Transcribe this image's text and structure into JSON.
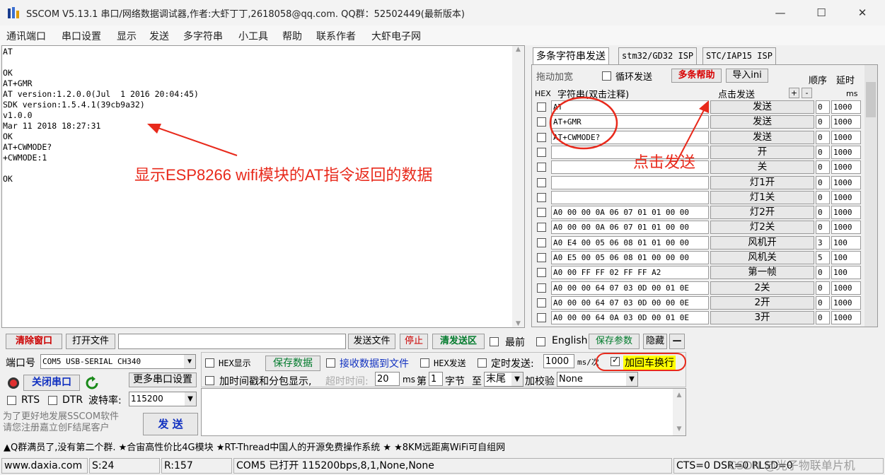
{
  "window": {
    "title": "SSCOM V5.13.1 串口/网络数据调试器,作者:大虾丁丁,2618058@qq.com. QQ群：52502449(最新版本)",
    "min": "—",
    "max": "☐",
    "close": "✕"
  },
  "menu": [
    "通讯端口",
    "串口设置",
    "显示",
    "发送",
    "多字符串",
    "小工具",
    "帮助",
    "联系作者",
    "大虾电子网"
  ],
  "receive": {
    "lines": "AT\n\nOK\nAT+GMR\nAT version:1.2.0.0(Jul  1 2016 20:04:45)\nSDK version:1.5.4.1(39cb9a32)\nv1.0.0\nMar 11 2018 18:27:31\nOK\nAT+CWMODE?\n+CWMODE:1\n\nOK",
    "annotation": "显示ESP8266 wifi模块的AT指令返回的数据"
  },
  "tabs": [
    "多条字符串发送",
    "stm32/GD32 ISP",
    "STC/IAP15 ISP"
  ],
  "multi": {
    "drag_label": "拖动加宽",
    "loop_label": "循环发送",
    "help_btn": "多条帮助",
    "import_btn": "导入ini",
    "order_label": "顺序",
    "delay_label": "延时",
    "hex_header": "HEX",
    "str_header": "字符串(双击注释)",
    "click_send_header": "点击发送",
    "plus": "+",
    "minus": "-",
    "ms": "ms",
    "annotation": "点击发送",
    "rows": [
      {
        "text": "AT",
        "btn": "发送",
        "order": "0",
        "delay": "1000"
      },
      {
        "text": "AT+GMR",
        "btn": "发送",
        "order": "0",
        "delay": "1000"
      },
      {
        "text": "AT+CWMODE?",
        "btn": "发送",
        "order": "0",
        "delay": "1000"
      },
      {
        "text": "",
        "btn": "开",
        "order": "0",
        "delay": "1000"
      },
      {
        "text": "",
        "btn": "关",
        "order": "0",
        "delay": "1000"
      },
      {
        "text": "",
        "btn": "灯1开",
        "order": "0",
        "delay": "1000"
      },
      {
        "text": "",
        "btn": "灯1关",
        "order": "0",
        "delay": "1000"
      },
      {
        "text": "A0 00 00 0A 06 07 01 01 00 00",
        "btn": "灯2开",
        "order": "0",
        "delay": "1000"
      },
      {
        "text": "A0 00 00 0A 06 07 01 01 00 00",
        "btn": "灯2关",
        "order": "0",
        "delay": "1000"
      },
      {
        "text": "A0 E4 00 05 06 08 01 01 00 00",
        "btn": "风机开",
        "order": "3",
        "delay": "100"
      },
      {
        "text": "A0 E5 00 05 06 08 01 00 00 00",
        "btn": "风机关",
        "order": "5",
        "delay": "100"
      },
      {
        "text": "A0 00 FF FF 02 FF FF A2",
        "btn": "第一帧",
        "order": "0",
        "delay": "100"
      },
      {
        "text": "A0 00 00 64 07 03 0D 00 01 0E",
        "btn": "2关",
        "order": "0",
        "delay": "1000"
      },
      {
        "text": "A0 00 00 64 07 03 0D 00 00 0E",
        "btn": "2开",
        "order": "0",
        "delay": "1000"
      },
      {
        "text": "A0 00 00 64 0A 03 0D 00 01 0E",
        "btn": "3开",
        "order": "0",
        "delay": "1000"
      }
    ]
  },
  "toolbar": {
    "clear_btn": "清除窗口",
    "open_file_btn": "打开文件",
    "send_file_btn": "发送文件",
    "stop_btn": "停止",
    "clear_send_btn": "清发送区",
    "front_label": "最前",
    "english_label": "English",
    "save_params_btn": "保存参数",
    "hide_btn": "隐藏",
    "dash_btn": "—"
  },
  "port": {
    "port_label": "端口号",
    "port_value": "COM5 USB-SERIAL CH340",
    "more_settings_btn": "更多串口设置",
    "close_port_btn": "关闭串口",
    "rts_label": "RTS",
    "dtr_label": "DTR",
    "baud_label": "波特率:",
    "baud_value": "115200",
    "promo": "为了更好地发展SSCOM软件\n请您注册嘉立创F结尾客户",
    "send_btn": "发 送"
  },
  "options": {
    "hex_display": "HEX显示",
    "save_data_btn": "保存数据",
    "recv_to_file": "接收数据到文件",
    "hex_send": "HEX发送",
    "timed_send": "定时发送:",
    "timed_value": "1000",
    "timed_unit": "ms/次",
    "add_crlf": "加回车换行",
    "timestamp_label": "加时间戳和分包显示,",
    "timeout_label": "超时时间:",
    "timeout_value": "20",
    "ms": "ms",
    "nth_label": "第",
    "nth_value": "1",
    "byte_label": "字节",
    "to_label": "至",
    "to_value": "末尾",
    "checksum_label": "加校验",
    "checksum_value": "None"
  },
  "ticker": "▲Q群满员了,没有第二个群. ★合宙高性价比4G模块 ★RT-Thread中国人的开源免费操作系统 ★ ★8KM远距离WiFi可自组网",
  "status": {
    "site": "www.daxia.com",
    "sent": "S:24",
    "recv": "R:157",
    "port_status": "COM5 已打开  115200bps,8,1,None,None",
    "lines": "CTS=0 DSR=0 RLSD=0",
    "watermark": "CSDN @光子物联单片机"
  },
  "colors": {
    "annotation_red": "#e8291b",
    "highlight_yellow": "#ffff00",
    "button_red": "#cc0000",
    "button_green": "#007a2b",
    "button_blue": "#1030c0"
  }
}
